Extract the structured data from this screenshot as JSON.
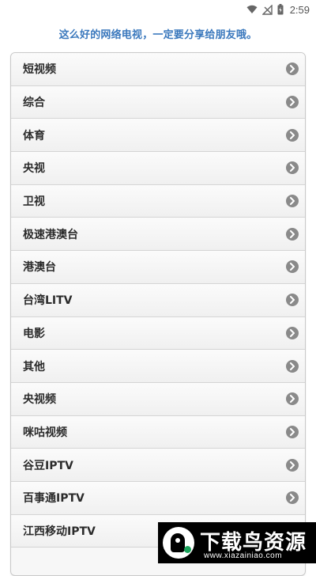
{
  "status_bar": {
    "time": "2:59",
    "icons": [
      "wifi-icon",
      "no-signal-icon",
      "battery-charging-icon"
    ]
  },
  "share_text": "这么好的网络电视，一定要分享给朋友哦。",
  "channel_list": {
    "items": [
      {
        "label": "短视频"
      },
      {
        "label": "综合"
      },
      {
        "label": "体育"
      },
      {
        "label": "央视"
      },
      {
        "label": "卫视"
      },
      {
        "label": "极速港澳台"
      },
      {
        "label": "港澳台"
      },
      {
        "label": "台湾LITV"
      },
      {
        "label": "电影"
      },
      {
        "label": "其他"
      },
      {
        "label": "央视频"
      },
      {
        "label": "咪咕视频"
      },
      {
        "label": "谷豆IPTV"
      },
      {
        "label": "百事通IPTV"
      },
      {
        "label": "江西移动IPTV"
      }
    ],
    "arrow_icon": "chevron-right-circle-icon"
  },
  "watermark": {
    "title": "下载鸟资源",
    "url": "www.xiazainiao.com"
  },
  "colors": {
    "share_text": "#3a78bd",
    "arrow_icon_bg": "#8a8a8a",
    "list_border": "#c9c9c9"
  }
}
